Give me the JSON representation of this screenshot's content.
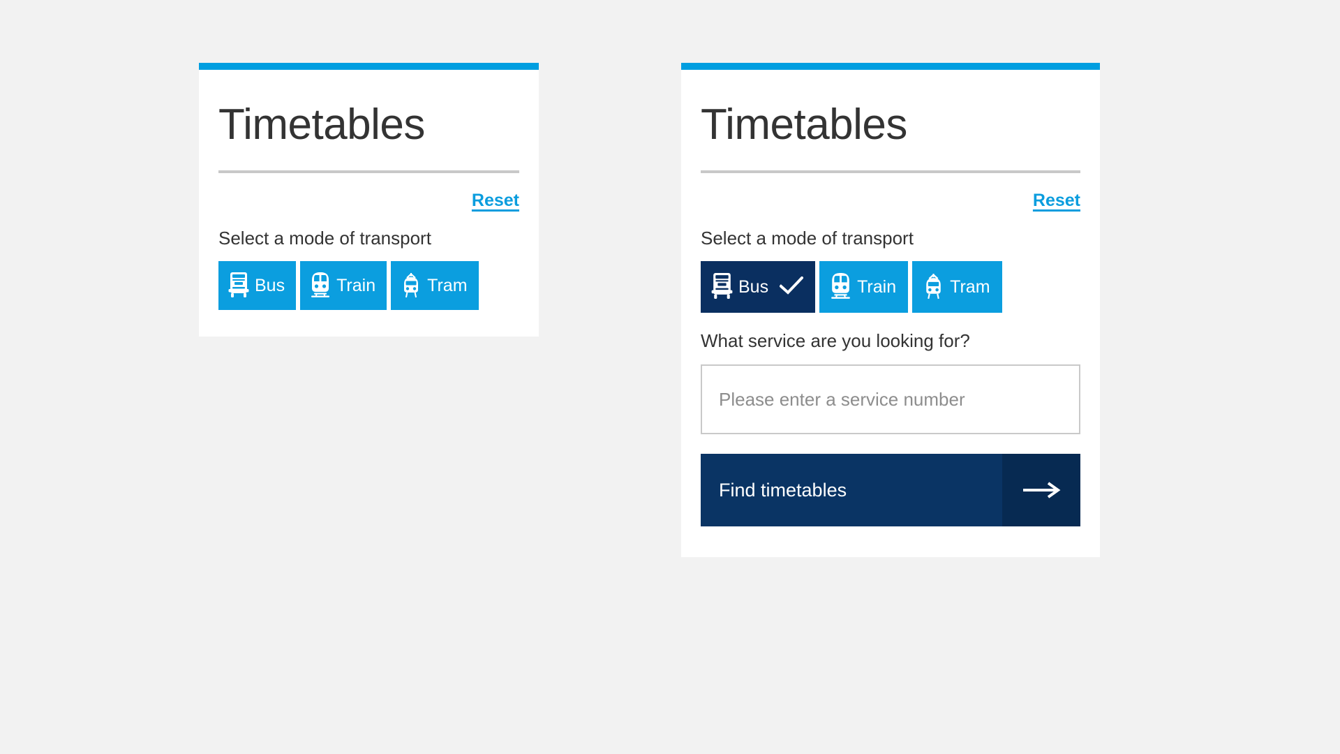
{
  "page": {
    "background_color": "#f2f2f2"
  },
  "colors": {
    "accent_blue": "#009ee0",
    "mode_blue": "#0b9edf",
    "selected_navy": "#0a2f60",
    "submit_navy": "#0a3464",
    "submit_arrow_navy": "#072a52",
    "link_blue": "#0b9dde",
    "rule_gray": "#c8c8c8",
    "text_dark": "#333333",
    "placeholder_gray": "#8d8d8d"
  },
  "cards": [
    {
      "id": "timetables-initial",
      "title": "Timetables",
      "reset_label": "Reset",
      "mode_label": "Select a mode of transport",
      "modes": [
        {
          "label": "Bus",
          "icon": "bus-icon",
          "selected": false
        },
        {
          "label": "Train",
          "icon": "train-icon",
          "selected": false
        },
        {
          "label": "Tram",
          "icon": "tram-icon",
          "selected": false
        }
      ]
    },
    {
      "id": "timetables-bus-selected",
      "title": "Timetables",
      "reset_label": "Reset",
      "mode_label": "Select a mode of transport",
      "modes": [
        {
          "label": "Bus",
          "icon": "bus-icon",
          "selected": true,
          "check": "check-icon"
        },
        {
          "label": "Train",
          "icon": "train-icon",
          "selected": false
        },
        {
          "label": "Tram",
          "icon": "tram-icon",
          "selected": false
        }
      ],
      "service_label": "What service are you looking for?",
      "service_input": {
        "value": "",
        "placeholder": "Please enter a service number"
      },
      "submit": {
        "label": "Find timetables",
        "icon": "arrow-right-icon"
      }
    }
  ]
}
